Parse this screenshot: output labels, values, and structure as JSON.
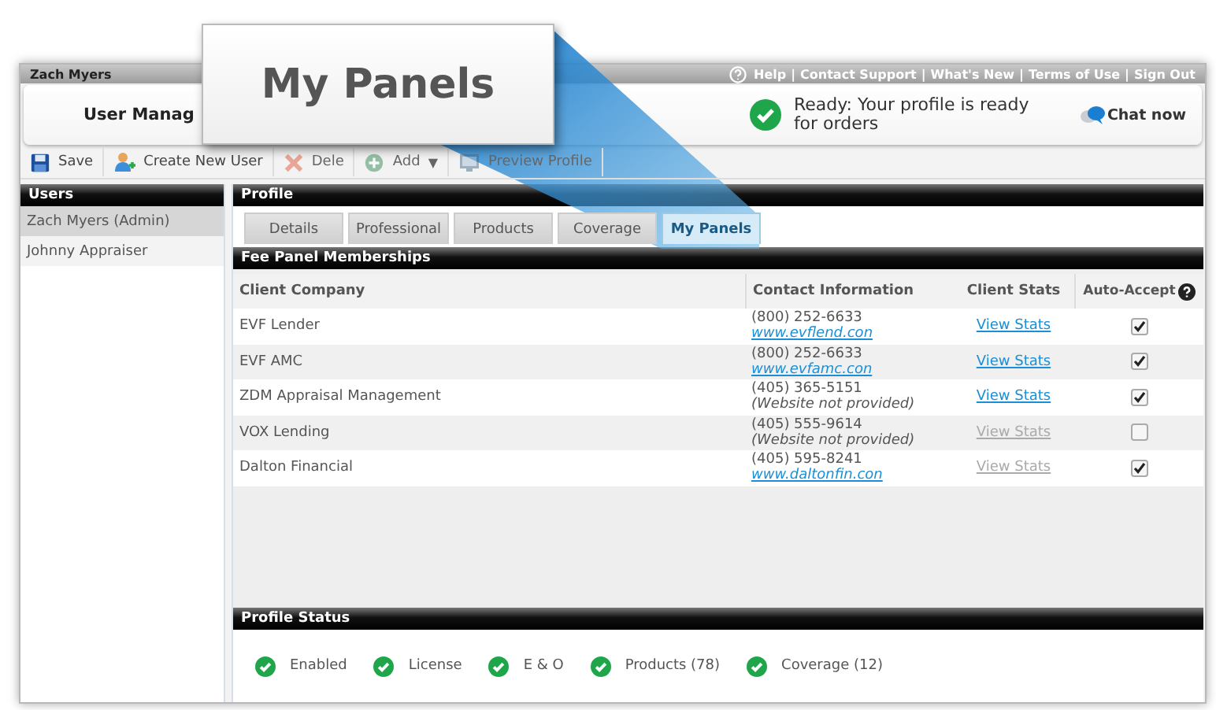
{
  "callout": {
    "title": "My Panels"
  },
  "top_bar": {
    "user": "Zach Myers",
    "separator": "|",
    "links": [
      "Help",
      "Contact Support",
      "What's New",
      "Terms of Use",
      "Sign Out"
    ]
  },
  "header": {
    "title": "User Manag",
    "status": "Ready: Your profile is ready for orders",
    "chat": "Chat now"
  },
  "toolbar": [
    {
      "kind": "save",
      "label": "Save",
      "disabled": false
    },
    {
      "kind": "user",
      "label": "Create New User",
      "disabled": false
    },
    {
      "kind": "delete",
      "label": "Dele",
      "disabled": true
    },
    {
      "kind": "add",
      "label": "Add",
      "caret": "▼",
      "disabled": true
    },
    {
      "kind": "preview",
      "label": "Preview Profile",
      "disabled": true
    }
  ],
  "sidebar": {
    "title": "Users",
    "items": [
      {
        "label": "Zach Myers (Admin)",
        "selected": true
      },
      {
        "label": "Johnny Appraiser",
        "selected": false
      }
    ]
  },
  "profile": {
    "title": "Profile",
    "tabs": [
      {
        "label": "Details",
        "selected": false
      },
      {
        "label": "Professional",
        "selected": false
      },
      {
        "label": "Products",
        "selected": false
      },
      {
        "label": "Coverage",
        "selected": false
      },
      {
        "label": "My Panels",
        "selected": true
      }
    ],
    "section_title": "Fee Panel Memberships",
    "table": {
      "columns": [
        "Client Company",
        "Contact Information",
        "Client Stats",
        "Auto-Accept"
      ],
      "rows": [
        {
          "company": "EVF Lender",
          "phone": "(800) 252-6633",
          "website": {
            "kind": "link",
            "text": "www.evflend.con"
          },
          "stats": {
            "label": "View Stats",
            "disabled": false
          },
          "auto_accept": true
        },
        {
          "company": "EVF AMC",
          "phone": "(800) 252-6633",
          "website": {
            "kind": "link",
            "text": "www.evfamc.con"
          },
          "stats": {
            "label": "View Stats",
            "disabled": false
          },
          "auto_accept": true
        },
        {
          "company": "ZDM Appraisal Management",
          "phone": "(405) 365-5151",
          "website": {
            "kind": "note",
            "text": "(Website not provided)"
          },
          "stats": {
            "label": "View Stats",
            "disabled": false
          },
          "auto_accept": true
        },
        {
          "company": "VOX Lending",
          "phone": "(405) 555-9614",
          "website": {
            "kind": "note",
            "text": "(Website not provided)"
          },
          "stats": {
            "label": "View Stats",
            "disabled": true
          },
          "auto_accept": false
        },
        {
          "company": "Dalton Financial",
          "phone": "(405) 595-8241",
          "website": {
            "kind": "link",
            "text": "www.daltonfin.con"
          },
          "stats": {
            "label": "View Stats",
            "disabled": true
          },
          "auto_accept": true
        }
      ]
    },
    "status_title": "Profile Status",
    "status_items": [
      {
        "label": "Enabled",
        "ok": true
      },
      {
        "label": "License",
        "ok": true
      },
      {
        "label": "E & O",
        "ok": true
      },
      {
        "label": "Products (78)",
        "ok": true
      },
      {
        "label": "Coverage (12)",
        "ok": true
      }
    ]
  }
}
